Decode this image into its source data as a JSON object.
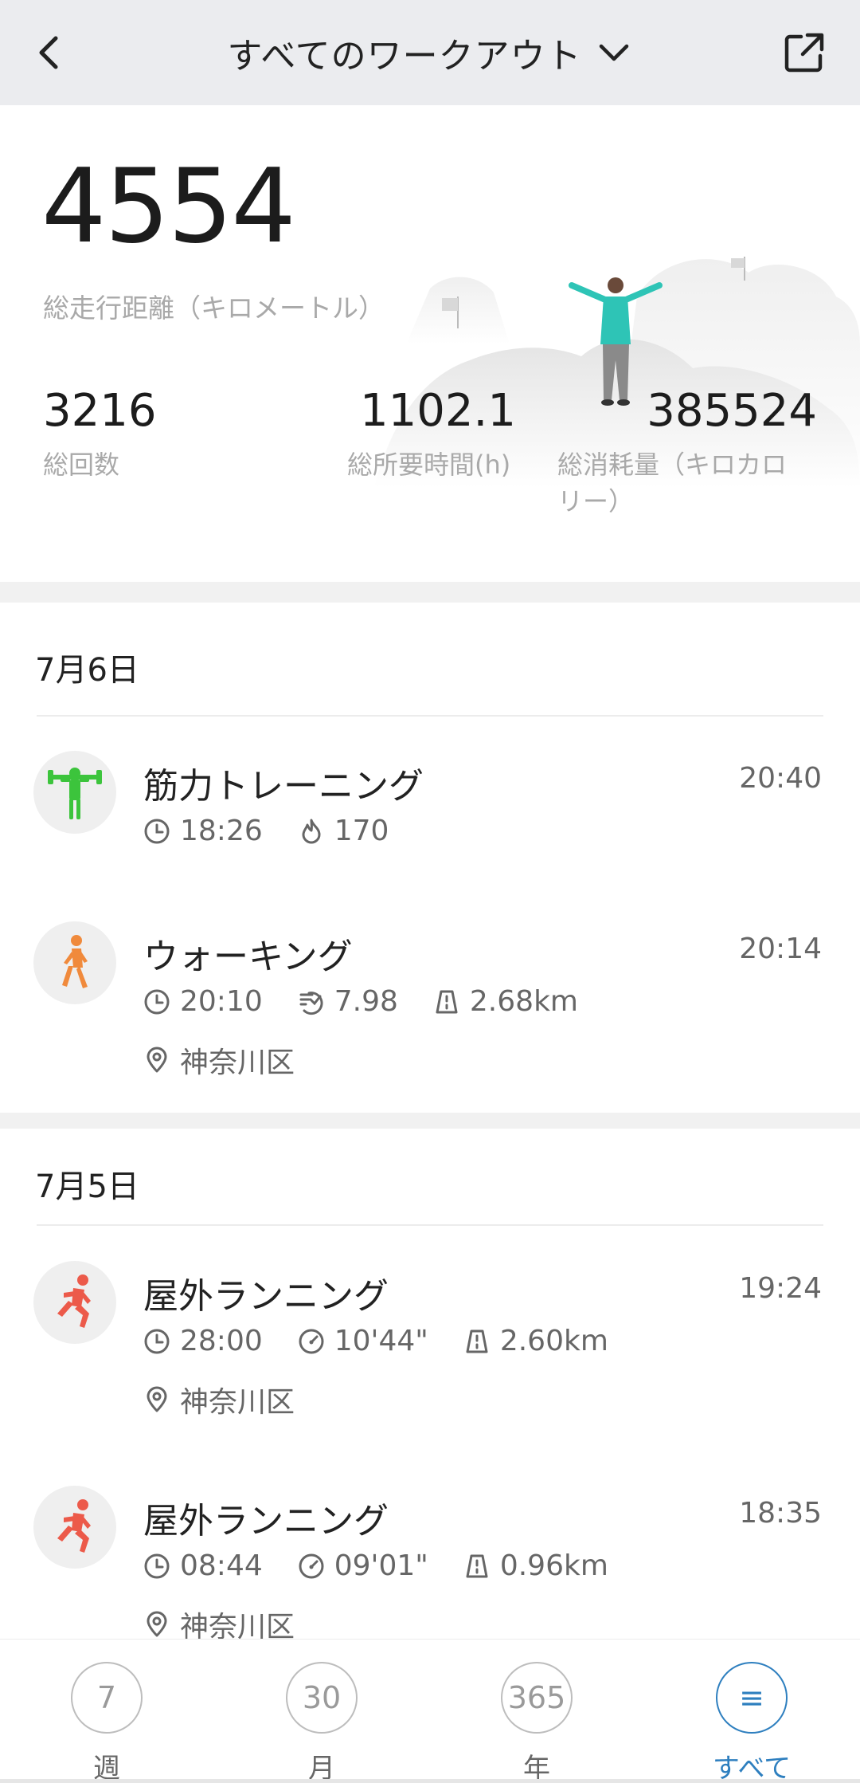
{
  "header": {
    "title": "すべてのワークアウト",
    "back_icon": "chevron-left-icon",
    "dropdown_icon": "chevron-down-icon",
    "share_icon": "share-icon"
  },
  "summary": {
    "total_distance": "4554",
    "total_distance_label": "総走行距離（キロメートル）",
    "count": "3216",
    "count_label": "総回数",
    "duration": "1102.1",
    "duration_label": "総所要時間(h)",
    "calories": "385524",
    "calories_label_1": "総消耗量（キロカロ",
    "calories_label_2": "リー）"
  },
  "days": [
    {
      "date": "7月6日",
      "workouts": [
        {
          "icon": "strength-training-icon",
          "icon_color": "#3cc43c",
          "title": "筋力トレーニング",
          "time": "20:40",
          "duration": "18:26",
          "calories": "170"
        },
        {
          "icon": "walking-icon",
          "icon_color": "#f08a3c",
          "title": "ウォーキング",
          "time": "20:14",
          "duration": "20:10",
          "steps": "7.98",
          "distance": "2.68km",
          "location": "神奈川区"
        }
      ]
    },
    {
      "date": "7月5日",
      "workouts": [
        {
          "icon": "running-icon",
          "icon_color": "#ec5a4a",
          "title": "屋外ランニング",
          "time": "19:24",
          "duration": "28:00",
          "pace": "10'44\"",
          "distance": "2.60km",
          "location": "神奈川区"
        },
        {
          "icon": "running-icon",
          "icon_color": "#ec5a4a",
          "title": "屋外ランニング",
          "time": "18:35",
          "duration": "08:44",
          "pace": "09'01\"",
          "distance": "0.96km",
          "location": "神奈川区"
        }
      ]
    }
  ],
  "bottom_nav": [
    {
      "circle": "7",
      "label": "週"
    },
    {
      "circle": "30",
      "label": "月"
    },
    {
      "circle": "365",
      "label": "年"
    },
    {
      "circle": "≡",
      "label": "すべて",
      "active": true
    }
  ],
  "colors": {
    "accent": "#2e7fbf",
    "topbar": "#ebecef"
  }
}
